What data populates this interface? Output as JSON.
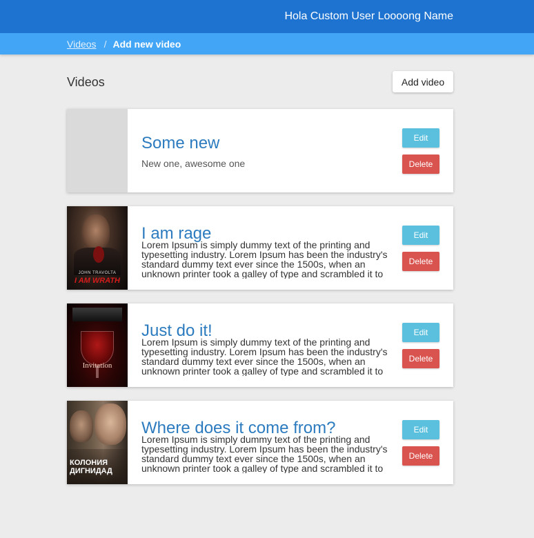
{
  "header": {
    "user_name": "Hola Custom User Loooong Name",
    "bg_color": "#1e73d0"
  },
  "breadcrumb": {
    "link": "Videos",
    "separator": "/",
    "current": "Add new video"
  },
  "page": {
    "title": "Videos",
    "add_button": "Add video"
  },
  "videos": [
    {
      "title": "Some new",
      "description": "New one, awesome one",
      "has_thumbnail": false,
      "edit_label": "Edit",
      "delete_label": "Delete"
    },
    {
      "title": "I am rage",
      "description": "Lorem Ipsum is simply dummy text of the printing and typesetting industry. Lorem Ipsum has been the industry's standard dummy text ever since the 1500s, when an unknown printer took a galley of type and scrambled it to",
      "has_thumbnail": true,
      "poster_caption": "I AM WRATH",
      "poster_actor": "JOHN TRAVOLTA",
      "edit_label": "Edit",
      "delete_label": "Delete"
    },
    {
      "title": "Just do it!",
      "description": "Lorem Ipsum is simply dummy text of the printing and typesetting industry. Lorem Ipsum has been the industry's standard dummy text ever since the 1500s, when an unknown printer took a galley of type and scrambled it to",
      "has_thumbnail": true,
      "poster_caption": "Invitation",
      "edit_label": "Edit",
      "delete_label": "Delete"
    },
    {
      "title": "Where does it come from?",
      "description": "Lorem Ipsum is simply dummy text of the printing and typesetting industry. Lorem Ipsum has been the industry's standard dummy text ever since the 1500s, when an unknown printer took a galley of type and scrambled it to",
      "has_thumbnail": true,
      "poster_caption": "КОЛОНИЯ ДИГНИДАД",
      "edit_label": "Edit",
      "delete_label": "Delete"
    }
  ],
  "colors": {
    "accent": "#42a5f5",
    "title": "#2c7bbf",
    "edit": "#5bc0de",
    "delete": "#d9534f"
  }
}
